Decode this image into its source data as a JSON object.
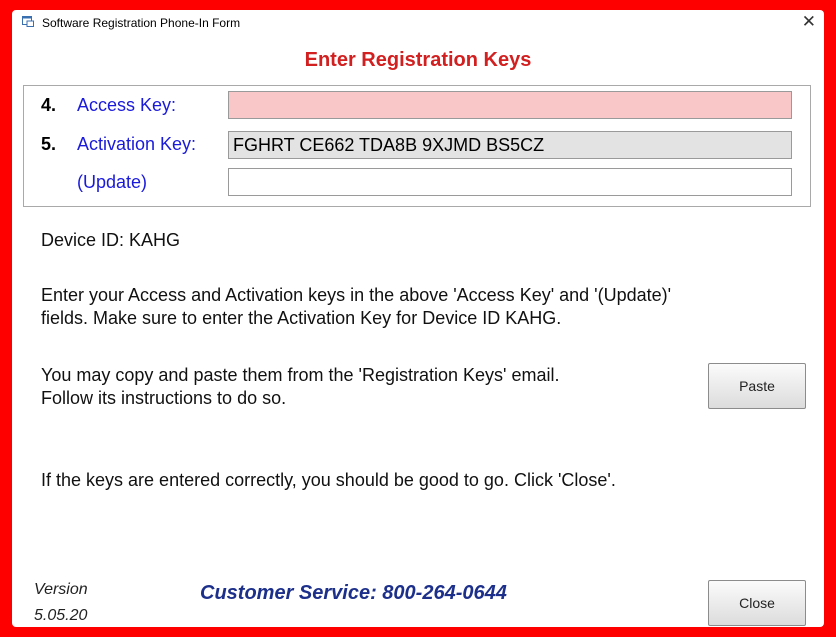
{
  "window": {
    "title": "Software Registration Phone-In Form"
  },
  "heading": "Enter Registration Keys",
  "keys": {
    "access": {
      "number": "4.",
      "label": "Access Key:",
      "value": ""
    },
    "activation": {
      "number": "5.",
      "label": "Activation Key:",
      "value": "FGHRT CE662 TDA8B 9XJMD BS5CZ"
    },
    "update": {
      "label": "(Update)",
      "value": ""
    }
  },
  "device_id": "Device ID:  KAHG",
  "instructions": {
    "line1": "Enter your Access and Activation keys in the above 'Access Key' and '(Update)'",
    "line2": "fields. Make sure to enter the Activation Key for Device ID KAHG.",
    "line3": "You may copy and paste them from the 'Registration Keys' email.",
    "line4": "Follow its instructions to do so.",
    "line5": "If the keys are entered correctly, you should be good to go.   Click 'Close'."
  },
  "buttons": {
    "paste": "Paste",
    "close": "Close"
  },
  "footer": {
    "version_label": "Version",
    "version_number": "5.05.20",
    "customer_service": "Customer Service: 800-264-0644"
  },
  "colors": {
    "frame": "#ff0000",
    "heading": "#d21f1f",
    "label": "#1a1adb",
    "service": "#1c2f8a",
    "access_field": "#f9c7c7"
  },
  "icons": {
    "app": "app-form-icon",
    "close": "close-icon"
  }
}
